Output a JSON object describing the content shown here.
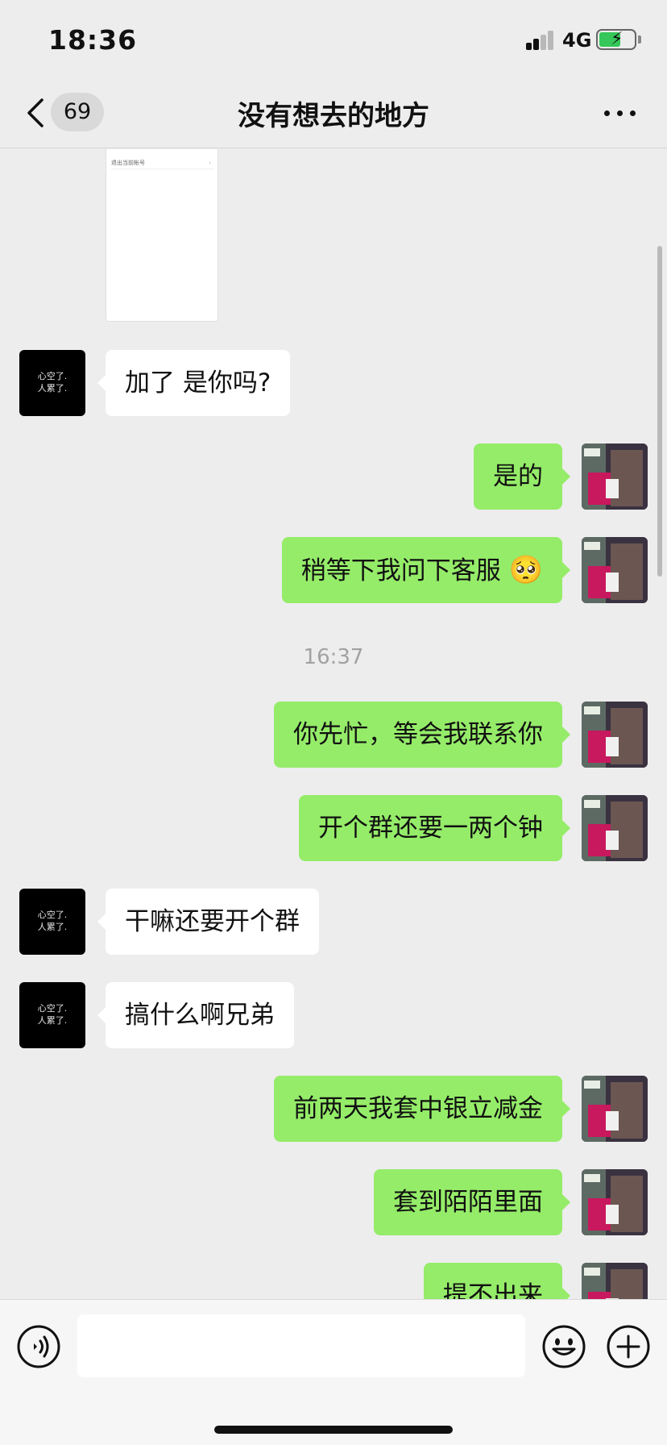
{
  "status_bar": {
    "time": "18:36",
    "network": "4G",
    "icons": [
      "signal-icon",
      "battery-charging-icon"
    ]
  },
  "nav": {
    "back_icon": "chevron-left-icon",
    "unread_count": "69",
    "title": "没有想去的地方",
    "more_icon": "more-dots-icon"
  },
  "messages": [
    {
      "type": "image",
      "from": "other",
      "preview_text": "退出当前帐号"
    },
    {
      "type": "text",
      "from": "other",
      "text": "加了 是你吗?"
    },
    {
      "type": "text",
      "from": "me",
      "text": "是的"
    },
    {
      "type": "text",
      "from": "me",
      "text": "稍等下我问下客服",
      "emoji": "pleading-face-emoji"
    },
    {
      "type": "time",
      "text": "16:37"
    },
    {
      "type": "text",
      "from": "me",
      "text": "你先忙，等会我联系你"
    },
    {
      "type": "text",
      "from": "me",
      "text": "开个群还要一两个钟"
    },
    {
      "type": "text",
      "from": "other",
      "text": "干嘛还要开个群"
    },
    {
      "type": "text",
      "from": "other",
      "text": "搞什么啊兄弟"
    },
    {
      "type": "text",
      "from": "me",
      "text": "前两天我套中银立减金"
    },
    {
      "type": "text",
      "from": "me",
      "text": "套到陌陌里面"
    },
    {
      "type": "text",
      "from": "me",
      "text": "提不出来"
    }
  ],
  "other_avatar_text": [
    "心空了.",
    "人累了."
  ],
  "input_bar": {
    "voice_icon": "voice-icon",
    "message_value": "",
    "emoji_icon": "emoji-icon",
    "plus_icon": "plus-icon"
  },
  "colors": {
    "background": "#ededed",
    "my_bubble": "#95ec69",
    "their_bubble": "#ffffff",
    "timestamp": "#a2a2a2"
  }
}
